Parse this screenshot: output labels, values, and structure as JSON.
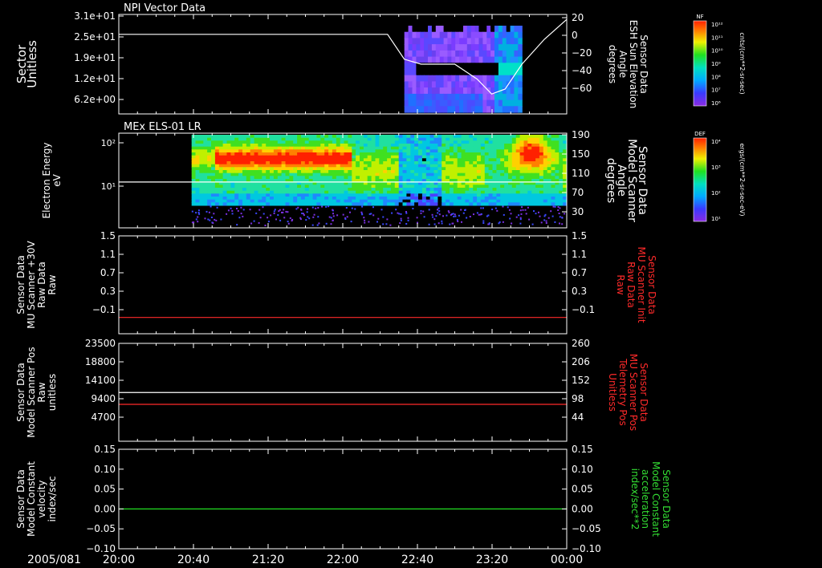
{
  "panels": [
    {
      "title": "NPI Vector Data",
      "left_label": [
        "Sector",
        "Unitless"
      ],
      "left_ticks": [
        "3.1e+01",
        "2.5e+01",
        "1.9e+01",
        "1.2e+01",
        "6.2e+00"
      ],
      "right_label": [
        "Sensor Data",
        "ESH Sun Elevation",
        "Angle",
        "degrees"
      ],
      "right_label_color": "#ffffff",
      "right_ticks": [
        "20",
        "0",
        "−20",
        "−40",
        "−60"
      ],
      "colorbar": {
        "label": "NF",
        "units": "cnts/(cm**2-sr-sec)",
        "ticks": [
          "10¹²",
          "10¹¹",
          "10¹⁰",
          "10⁹",
          "10⁸",
          "10⁷",
          "10⁶"
        ]
      }
    },
    {
      "title": "MEx ELS-01 LR",
      "left_label": [
        "Electron Energy",
        "eV"
      ],
      "left_ticks": [
        "10²",
        "10¹"
      ],
      "right_label": [
        "Sensor Data",
        "Model Scanner",
        "Angle",
        "degrees"
      ],
      "right_label_color": "#ffffff",
      "right_ticks": [
        "190",
        "150",
        "110",
        "70",
        "30"
      ],
      "colorbar": {
        "label": "DEF",
        "units": "ergs/(cm**2-sr-sec-eV)",
        "ticks": [
          "10⁴",
          "10³",
          "10²",
          "10¹"
        ]
      }
    },
    {
      "title": "",
      "left_label": [
        "Sensor Data",
        "MU Scanner +30V",
        "Raw Data",
        "Raw"
      ],
      "left_ticks": [
        "1.5",
        "1.1",
        "0.7",
        "0.3",
        "−0.1"
      ],
      "right_label": [
        "Sensor Data",
        "MU Scanner Init",
        "Raw Data",
        "Raw"
      ],
      "right_label_color": "#ff2a2a",
      "right_ticks": [
        "1.5",
        "1.1",
        "0.7",
        "0.3",
        "−0.1"
      ]
    },
    {
      "title": "",
      "left_label": [
        "Sensor Data",
        "Model Scanner Pos",
        "Raw",
        "unitless"
      ],
      "left_ticks": [
        "23500",
        "18800",
        "14100",
        "9400",
        "4700"
      ],
      "right_label": [
        "Sensor Data",
        "MU Scanner Pos",
        "Telemetry Pos",
        "Unitless"
      ],
      "right_label_color": "#ff2a2a",
      "right_ticks": [
        "260",
        "206",
        "152",
        "98",
        "44"
      ]
    },
    {
      "title": "",
      "left_label": [
        "Sensor Data",
        "Model Constant",
        "velocity",
        "index/sec"
      ],
      "left_ticks": [
        "0.15",
        "0.10",
        "0.05",
        "0.00",
        "−0.05",
        "−0.10"
      ],
      "right_label": [
        "Sensor Data",
        "Model Constant",
        "acceleration",
        "index/sec**2"
      ],
      "right_label_color": "#33dd33",
      "right_ticks": [
        "0.15",
        "0.10",
        "0.05",
        "0.00",
        "−0.05",
        "−0.10"
      ]
    }
  ],
  "date_label": "2005/081",
  "x_ticks": [
    "20:00",
    "20:40",
    "21:20",
    "22:00",
    "22:40",
    "23:20",
    "00:00"
  ],
  "colors": {
    "white_line": "#ffffff",
    "red_line": "#ff2a2a",
    "green_line": "#22dd22"
  },
  "chart_data": [
    {
      "type": "heatmap",
      "title": "NPI Vector Data",
      "xlabel": "",
      "ylabel": "Sector Unitless",
      "x_ticks": [
        "20:00",
        "20:40",
        "21:20",
        "22:00",
        "22:40",
        "23:20",
        "00:00"
      ],
      "y_ticks": [
        31,
        25,
        19,
        12,
        6.2
      ],
      "data_coverage_hours": [
        22.55,
        23.6
      ],
      "overlay_line": {
        "name": "ESH Sun Elevation Angle",
        "units": "degrees",
        "y_range": [
          -80,
          20
        ],
        "x_hours": [
          20.0,
          22.4,
          22.55,
          22.7,
          23.0,
          23.2,
          23.33,
          23.45,
          23.6,
          23.8,
          24.0
        ],
        "y": [
          0,
          0,
          -25,
          -30,
          -30,
          -45,
          -60,
          -55,
          -30,
          -5,
          15
        ]
      }
    },
    {
      "type": "heatmap",
      "title": "MEx ELS-01 LR",
      "xlabel": "",
      "ylabel": "Electron Energy eV",
      "y_scale": "log",
      "y_ticks": [
        100,
        10
      ],
      "data_coverage_hours": [
        20.65,
        24.0
      ],
      "overlay_line": {
        "name": "Model Scanner Angle",
        "units": "degrees",
        "y_range": [
          0,
          190
        ],
        "x_hours": [
          20.0,
          24.0
        ],
        "y": [
          92,
          92
        ]
      }
    },
    {
      "type": "line",
      "ylabel": "MU Scanner +30V Raw Data",
      "ylim": [
        -0.3,
        1.5
      ],
      "series": [
        {
          "name": "MU Scanner Init Raw Data",
          "x_hours": [
            20.0,
            24.0
          ],
          "y": [
            0.0,
            0.0
          ]
        }
      ]
    },
    {
      "type": "line",
      "ylabel": "Model Scanner Pos Raw",
      "ylim": [
        0,
        23500
      ],
      "y2lim": [
        0,
        260
      ],
      "series": [
        {
          "name": "Model Scanner Pos",
          "x_hours": [
            20.0,
            24.0
          ],
          "y": [
            11700,
            11700
          ]
        },
        {
          "name": "MU Scanner Pos Telemetry Pos",
          "axis": "right",
          "x_hours": [
            20.0,
            24.0
          ],
          "y": [
            98,
            98
          ]
        }
      ]
    },
    {
      "type": "line",
      "ylabel": "Model Constant velocity index/sec",
      "ylim": [
        -0.1,
        0.15
      ],
      "series": [
        {
          "name": "Model Constant acceleration index/sec**2",
          "x_hours": [
            20.0,
            24.0
          ],
          "y": [
            0.0,
            0.0
          ]
        }
      ]
    }
  ]
}
